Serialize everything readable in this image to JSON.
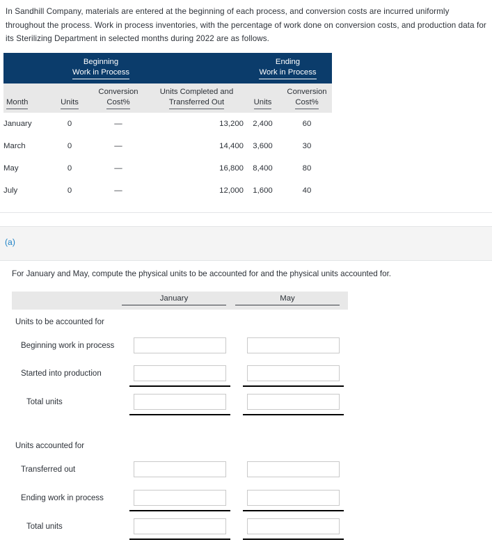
{
  "intro": {
    "paragraph": "In Sandhill Company, materials are entered at the beginning of each process, and conversion costs are incurred uniformly throughout the process. Work in process inventories, with the percentage of work done on conversion costs, and production data for its Sterilizing Department in selected months during 2022 are as follows."
  },
  "data_table": {
    "group_headers": [
      {
        "line1": "Beginning",
        "line2": "Work in Process"
      },
      {
        "line1": "Ending",
        "line2": "Work in Process"
      }
    ],
    "columns": [
      {
        "line1": "",
        "line2": "Month"
      },
      {
        "line1": "",
        "line2": "Units"
      },
      {
        "line1": "Conversion",
        "line2": "Cost%"
      },
      {
        "line1": "Units Completed and",
        "line2": "Transferred Out"
      },
      {
        "line1": "",
        "line2": "Units"
      },
      {
        "line1": "Conversion",
        "line2": "Cost%"
      }
    ],
    "rows": [
      {
        "month": "January",
        "bwip_units": "0",
        "bwip_conv": "—",
        "transferred_out": "13,200",
        "ewip_units": "2,400",
        "ewip_conv": "60"
      },
      {
        "month": "March",
        "bwip_units": "0",
        "bwip_conv": "—",
        "transferred_out": "14,400",
        "ewip_units": "3,600",
        "ewip_conv": "30"
      },
      {
        "month": "May",
        "bwip_units": "0",
        "bwip_conv": "—",
        "transferred_out": "16,800",
        "ewip_units": "8,400",
        "ewip_conv": "80"
      },
      {
        "month": "July",
        "bwip_units": "0",
        "bwip_conv": "—",
        "transferred_out": "12,000",
        "ewip_units": "1,600",
        "ewip_conv": "40"
      }
    ]
  },
  "part": {
    "label": "(a)",
    "question": "For January and May, compute the physical units to be accounted for and the physical units accounted for."
  },
  "form": {
    "column_headers": [
      "January",
      "May"
    ],
    "section_1_title": "Units to be accounted for",
    "section_1_rows": [
      "Beginning work in process",
      "Started into production"
    ],
    "section_1_total": "Total units",
    "section_2_title": "Units accounted for",
    "section_2_rows": [
      "Transferred out",
      "Ending work in process"
    ],
    "section_2_total": "Total units",
    "input_value": ""
  },
  "colors": {
    "navy": "#0b3c6b",
    "header_gray": "#e8e8e8",
    "banner_gray": "#f4f4f4",
    "link_blue": "#1e82c6",
    "text": "#2c3138"
  }
}
